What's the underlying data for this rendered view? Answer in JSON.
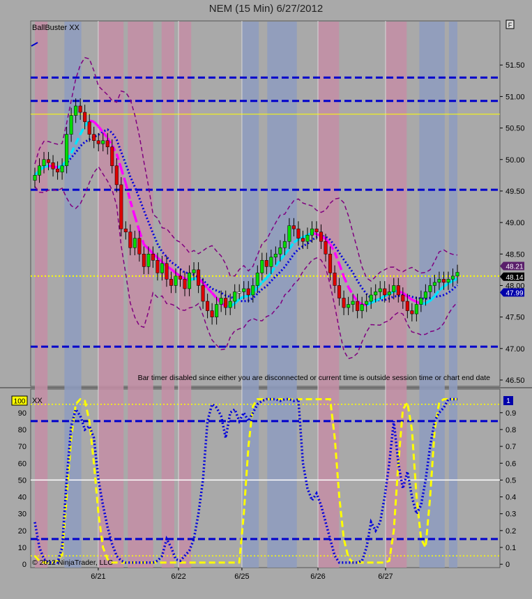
{
  "window": {
    "title": "NEM (15 Min)  6/27/2012"
  },
  "price_panel": {
    "indicator_name": "BallBuster XX",
    "timer_message": "Bar timer disabled since either you are disconnected or current time is outside session time or chart end date",
    "f_button": "F",
    "price_tag_upper": "48.21",
    "price_tag_mid": "48.14",
    "price_tag_lower": "47.99"
  },
  "osc_panel": {
    "name": "XX",
    "scale_badge": "100",
    "right_badge": "1",
    "copyright": "© 2012 NinjaTrader, LLC"
  },
  "colors": {
    "background": "#a9a9a9",
    "pink_band": "#c48ea6",
    "blue_band": "#8e9cc0",
    "level_line": "#0000cc",
    "yellow_line": "#ffff00",
    "bull_candle": "#00dd00",
    "bear_candle": "#dd0000",
    "doji_candle": "#ffffff",
    "ma_magenta": "#ff00ff",
    "ma_cyan": "#00e5ff",
    "ma_blue_dotted": "#0000dd",
    "bollinger": "#800080"
  },
  "chart_data": [
    {
      "type": "candlestick",
      "title": "NEM (15 Min)  6/27/2012",
      "x_ticks": [
        "6/21",
        "6/22",
        "6/25",
        "6/26",
        "6/27"
      ],
      "y_ticks": [
        "51.50",
        "51.00",
        "50.50",
        "50.00",
        "49.50",
        "49.00",
        "48.50",
        "48.00",
        "47.50",
        "47.00",
        "46.50"
      ],
      "ylim": [
        46.4,
        52.2
      ],
      "horizontal_levels": [
        51.3,
        50.93,
        49.52,
        47.03
      ],
      "yellow_levels": [
        50.72,
        48.15
      ],
      "session_shading": [
        {
          "color": "pink",
          "start": 0.0,
          "end": 0.03
        },
        {
          "color": "blue",
          "start": 0.07,
          "end": 0.11
        },
        {
          "color": "pink",
          "start": 0.15,
          "end": 0.21
        },
        {
          "color": "pink",
          "start": 0.22,
          "end": 0.28
        },
        {
          "color": "pink",
          "start": 0.3,
          "end": 0.33
        },
        {
          "color": "pink",
          "start": 0.34,
          "end": 0.37
        },
        {
          "color": "blue",
          "start": 0.49,
          "end": 0.53
        },
        {
          "color": "blue",
          "start": 0.55,
          "end": 0.62
        },
        {
          "color": "pink",
          "start": 0.67,
          "end": 0.72
        },
        {
          "color": "pink",
          "start": 0.83,
          "end": 0.88
        },
        {
          "color": "blue",
          "start": 0.91,
          "end": 0.97
        },
        {
          "color": "blue",
          "start": 0.98,
          "end": 1.0
        }
      ],
      "price_marks": [
        {
          "label": "48.21",
          "value": 48.21
        },
        {
          "label": "48.14",
          "value": 48.14
        },
        {
          "label": "47.99",
          "value": 47.99
        }
      ],
      "close_series": [
        49.75,
        49.9,
        50.0,
        49.95,
        49.85,
        49.8,
        49.9,
        50.4,
        50.7,
        50.85,
        50.75,
        50.6,
        50.4,
        50.3,
        50.25,
        50.3,
        50.2,
        49.9,
        49.6,
        48.9,
        48.85,
        48.6,
        48.75,
        48.5,
        48.3,
        48.5,
        48.4,
        48.2,
        48.35,
        48.1,
        48.0,
        48.15,
        48.1,
        47.95,
        48.2,
        48.25,
        48.0,
        47.75,
        47.6,
        47.5,
        47.7,
        47.8,
        47.65,
        47.75,
        47.9,
        47.9,
        47.95,
        47.85,
        48.0,
        48.2,
        48.4,
        48.3,
        48.45,
        48.5,
        48.6,
        48.7,
        48.95,
        48.9,
        48.75,
        48.7,
        48.8,
        48.9,
        48.85,
        48.7,
        48.5,
        48.2,
        48.0,
        47.8,
        47.65,
        47.7,
        47.75,
        47.6,
        47.7,
        47.75,
        47.85,
        47.9,
        47.95,
        47.85,
        47.9,
        48.0,
        47.85,
        47.75,
        47.6,
        47.55,
        47.7,
        47.8,
        47.9,
        48.0,
        48.05,
        48.1,
        48.05,
        48.1,
        48.15,
        48.21
      ]
    },
    {
      "type": "line",
      "name": "XX",
      "y_ticks_left": [
        "90",
        "80",
        "70",
        "60",
        "50",
        "40",
        "30",
        "20",
        "10",
        "0"
      ],
      "y_ticks_right": [
        "0.9",
        "0.8",
        "0.7",
        "0.6",
        "0.5",
        "0.4",
        "0.3",
        "0.2",
        "0.1",
        "0"
      ],
      "ylim": [
        -2,
        104
      ],
      "levels": {
        "blue_dashed": [
          85,
          15
        ],
        "white": 50,
        "yellow_dotted": [
          95,
          5
        ]
      },
      "series": [
        {
          "style": "yellow-dashed",
          "values": [
            5,
            2,
            1,
            1,
            1,
            2,
            6,
            40,
            75,
            95,
            98,
            97,
            85,
            60,
            30,
            10,
            3,
            1,
            1,
            1,
            1,
            1,
            1,
            1,
            1,
            1,
            1,
            1,
            1,
            1,
            1,
            1,
            1,
            1,
            1,
            1,
            1,
            1,
            1,
            1,
            1,
            1,
            1,
            1,
            1,
            1,
            30,
            70,
            94,
            98,
            98,
            98,
            98,
            98,
            98,
            98,
            98,
            98,
            98,
            98,
            98,
            98,
            98,
            98,
            98,
            98,
            75,
            40,
            15,
            4,
            1,
            1,
            1,
            1,
            1,
            1,
            1,
            1,
            2,
            20,
            60,
            92,
            96,
            80,
            40,
            15,
            10,
            40,
            80,
            96,
            98,
            98,
            98,
            98
          ]
        },
        {
          "style": "blue-dotted",
          "values": [
            25,
            10,
            3,
            1,
            1,
            1,
            10,
            50,
            82,
            92,
            88,
            80,
            82,
            75,
            50,
            35,
            22,
            12,
            5,
            2,
            1,
            1,
            1,
            1,
            1,
            1,
            1,
            2,
            5,
            15,
            10,
            3,
            2,
            5,
            8,
            15,
            30,
            50,
            85,
            95,
            93,
            88,
            75,
            90,
            92,
            85,
            90,
            85,
            90,
            95,
            97,
            98,
            98,
            98,
            97,
            98,
            98,
            97,
            98,
            60,
            45,
            38,
            42,
            35,
            25,
            15,
            5,
            1,
            1,
            1,
            1,
            1,
            2,
            10,
            25,
            20,
            25,
            40,
            60,
            85,
            60,
            45,
            55,
            40,
            30,
            35,
            50,
            70,
            85,
            90,
            93,
            98,
            98,
            98
          ]
        }
      ]
    }
  ]
}
